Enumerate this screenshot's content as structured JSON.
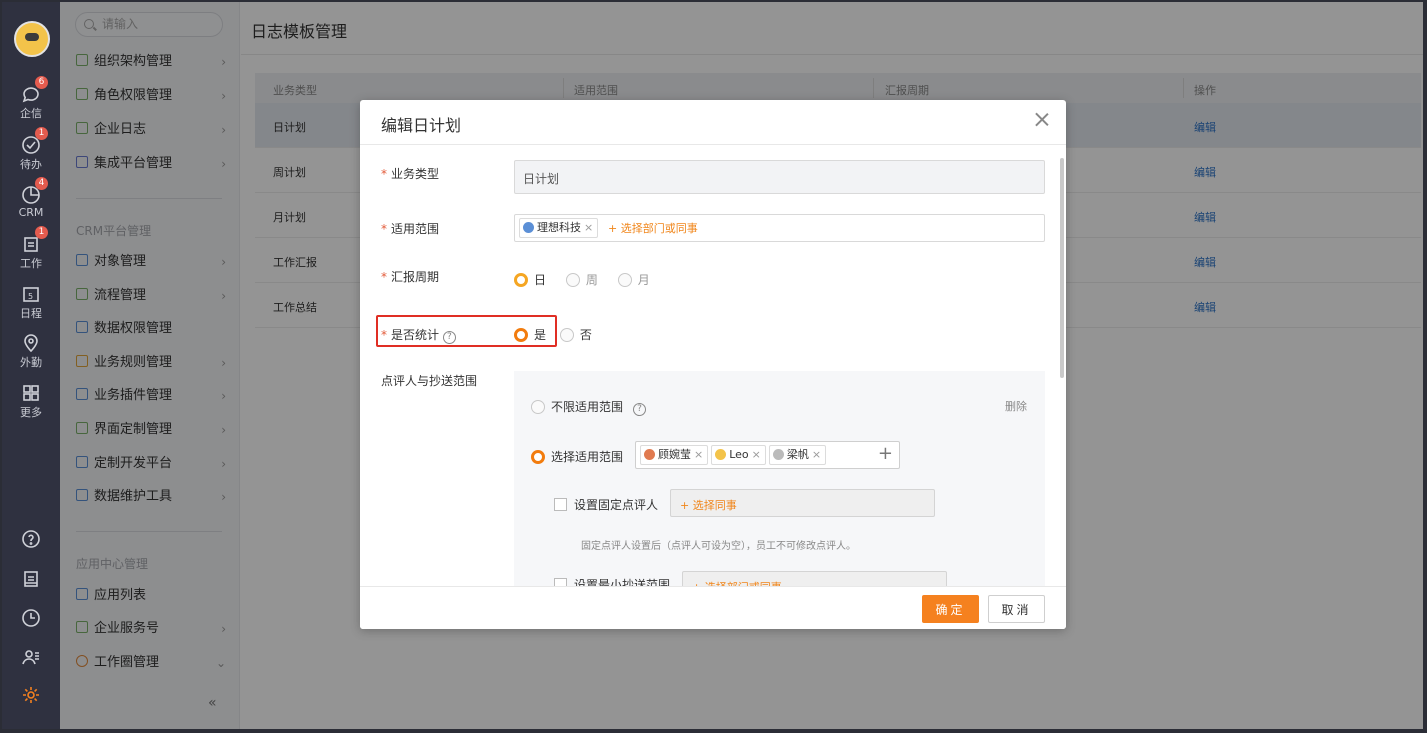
{
  "rail": {
    "items": [
      {
        "label": "企信",
        "badge": "6"
      },
      {
        "label": "待办",
        "badge": "1"
      },
      {
        "label": "CRM",
        "badge": "4"
      },
      {
        "label": "工作",
        "badge": "1"
      },
      {
        "label": "日程",
        "badge": "",
        "day": "5"
      },
      {
        "label": "外勤",
        "badge": ""
      },
      {
        "label": "更多",
        "badge": ""
      }
    ],
    "bottom_icons": [
      "help-icon",
      "document-icon",
      "clock-icon",
      "contacts-icon",
      "settings-icon"
    ],
    "active_color": "#f5811f"
  },
  "sidebar": {
    "search_placeholder": "请输入",
    "group1": [
      "组织架构管理",
      "角色权限管理",
      "企业日志",
      "集成平台管理"
    ],
    "group2_title": "CRM平台管理",
    "group2": [
      "对象管理",
      "流程管理",
      "数据权限管理",
      "业务规则管理",
      "业务插件管理",
      "界面定制管理",
      "定制开发平台",
      "数据维护工具"
    ],
    "group3_title": "应用中心管理",
    "group3": [
      "应用列表",
      "企业服务号",
      "工作圈管理"
    ],
    "collapse": "«"
  },
  "main": {
    "title": "日志模板管理",
    "columns": [
      "业务类型",
      "适用范围",
      "汇报周期",
      "操作"
    ],
    "rows": [
      {
        "type": "日计划",
        "action": "编辑"
      },
      {
        "type": "周计划",
        "action": "编辑"
      },
      {
        "type": "月计划",
        "action": "编辑"
      },
      {
        "type": "工作汇报",
        "action": "编辑"
      },
      {
        "type": "工作总结",
        "action": "编辑"
      }
    ]
  },
  "modal": {
    "title": "编辑日计划",
    "biz_type_label": "业务类型",
    "biz_type_value": "日计划",
    "scope_label": "适用范围",
    "scope_tag": "理想科技",
    "scope_add": "+ 选择部门或同事",
    "period_label": "汇报周期",
    "period_options": [
      "日",
      "周",
      "月"
    ],
    "period_selected": "日",
    "stat_label": "是否统计",
    "stat_options": [
      "是",
      "否"
    ],
    "stat_selected": "是",
    "reviewer_label": "点评人与抄送范围",
    "unlimited_label": "不限适用范围",
    "delete_label": "删除",
    "choose_label": "选择适用范围",
    "people": [
      "顾婉莹",
      "Leo",
      "梁帆"
    ],
    "fixed_reviewer_label": "设置固定点评人",
    "fixed_reviewer_add": "+ 选择同事",
    "fixed_reviewer_hint": "固定点评人设置后（点评人可设为空），员工不可修改点评人。",
    "min_cc_label": "设置最小抄送范围",
    "min_cc_add": "+ 选择部门或同事",
    "ok": "确定",
    "cancel": "取消"
  }
}
